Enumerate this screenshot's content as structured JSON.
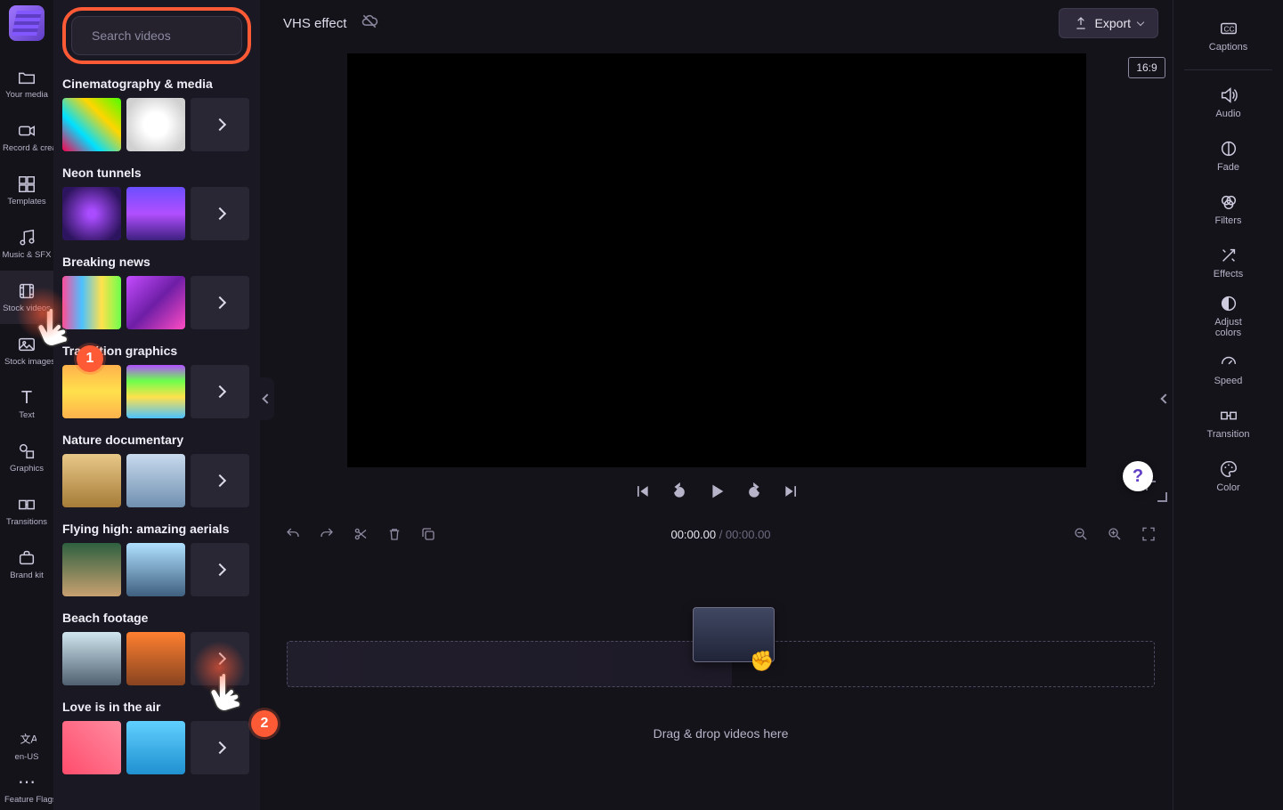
{
  "project": {
    "title": "VHS effect"
  },
  "header": {
    "export_label": "Export",
    "aspect_ratio": "16:9"
  },
  "search": {
    "placeholder": "Search videos"
  },
  "left_rail": {
    "items": [
      {
        "id": "your-media",
        "label": "Your media"
      },
      {
        "id": "record-create",
        "label": "Record & create"
      },
      {
        "id": "templates",
        "label": "Templates"
      },
      {
        "id": "music-sfx",
        "label": "Music & SFX"
      },
      {
        "id": "stock-videos",
        "label": "Stock videos",
        "active": true
      },
      {
        "id": "stock-images",
        "label": "Stock images"
      },
      {
        "id": "text",
        "label": "Text"
      },
      {
        "id": "graphics",
        "label": "Graphics"
      },
      {
        "id": "transitions",
        "label": "Transitions"
      },
      {
        "id": "brand-kit",
        "label": "Brand kit"
      }
    ],
    "footer": [
      {
        "id": "locale",
        "label": "en-US"
      },
      {
        "id": "feature-flags",
        "label": "Feature Flags"
      }
    ]
  },
  "right_rail": {
    "items": [
      {
        "id": "captions",
        "label": "Captions"
      },
      {
        "id": "audio",
        "label": "Audio"
      },
      {
        "id": "fade",
        "label": "Fade"
      },
      {
        "id": "filters",
        "label": "Filters"
      },
      {
        "id": "effects",
        "label": "Effects"
      },
      {
        "id": "adjust-colors",
        "label": "Adjust colors"
      },
      {
        "id": "speed",
        "label": "Speed"
      },
      {
        "id": "transition",
        "label": "Transition"
      },
      {
        "id": "color",
        "label": "Color"
      }
    ]
  },
  "media_categories": [
    {
      "title": "Cinematography & media"
    },
    {
      "title": "Neon tunnels"
    },
    {
      "title": "Breaking news"
    },
    {
      "title": "Transition graphics"
    },
    {
      "title": "Nature documentary"
    },
    {
      "title": "Flying high: amazing aerials"
    },
    {
      "title": "Beach footage"
    },
    {
      "title": "Love is in the air"
    }
  ],
  "timeline": {
    "current": "00:00.00",
    "separator": " / ",
    "total": "00:00.00",
    "drop_hint": "Drag & drop videos here"
  },
  "pointers": {
    "p1": "1",
    "p2": "2"
  },
  "help": {
    "label": "?"
  }
}
